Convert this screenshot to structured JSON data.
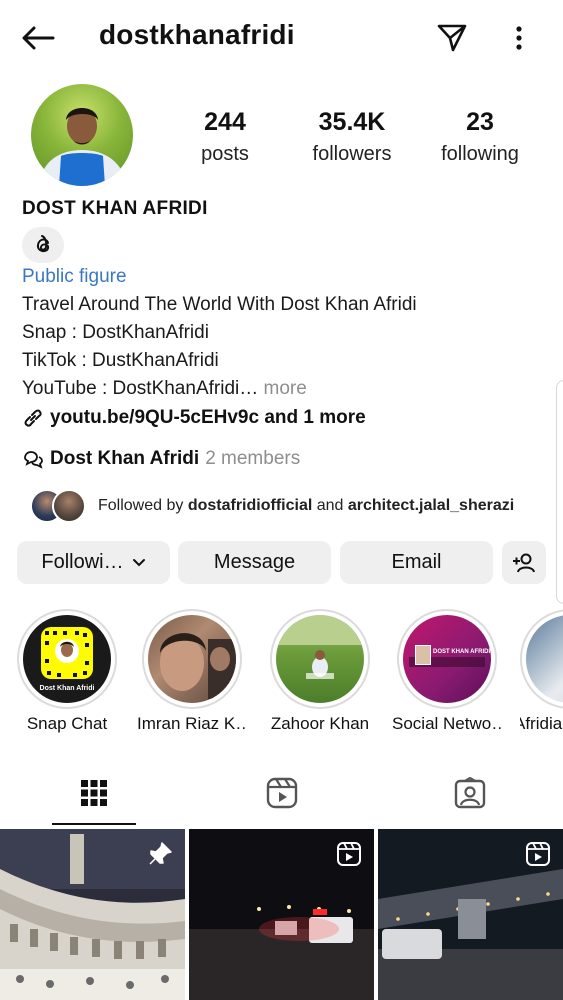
{
  "header": {
    "username": "dostkhanafridi"
  },
  "stats": {
    "posts": {
      "value": "244",
      "label": "posts"
    },
    "followers": {
      "value": "35.4K",
      "label": "followers"
    },
    "following": {
      "value": "23",
      "label": "following"
    }
  },
  "profile": {
    "full_name": "DOST KHAN AFRIDI",
    "category": "Public figure",
    "bio": [
      "Travel Around The World With Dost Khan Afridi",
      "Snap : DostKhanAfridi",
      "TikTok : DustKhanAfridi",
      "YouTube : DostKhanAfridi…"
    ],
    "bio_more": "more",
    "link": "youtu.be/9QU-5cEHv9c and 1 more",
    "channel_name": "Dost Khan Afridi",
    "channel_members": "2 members",
    "followed_by_prefix": "Followed by ",
    "followed_by_user1": "dostafridiofficial",
    "followed_by_and": " and ",
    "followed_by_user2": "architect.jalal_sherazi"
  },
  "actions": {
    "following_label": "Followi…",
    "message_label": "Message",
    "email_label": "Email"
  },
  "highlights": [
    {
      "label": "Snap Chat",
      "inner_text": "Dost Khan Afridi"
    },
    {
      "label": "Imran Riaz K…"
    },
    {
      "label": "Zahoor Khan"
    },
    {
      "label": "Social Netwo…",
      "inner_text": "DOST KHAN AFRIDI"
    },
    {
      "label": "Afridia"
    }
  ],
  "tabs": [
    {
      "icon": "grid-icon",
      "active": true
    },
    {
      "icon": "reels-icon",
      "active": false
    },
    {
      "icon": "tagged-icon",
      "active": false
    }
  ],
  "colors": {
    "link_blue": "#3a78c3",
    "muted": "#8e8e8e",
    "button_bg": "#efefef",
    "snapchat_yellow": "#fffc00"
  }
}
